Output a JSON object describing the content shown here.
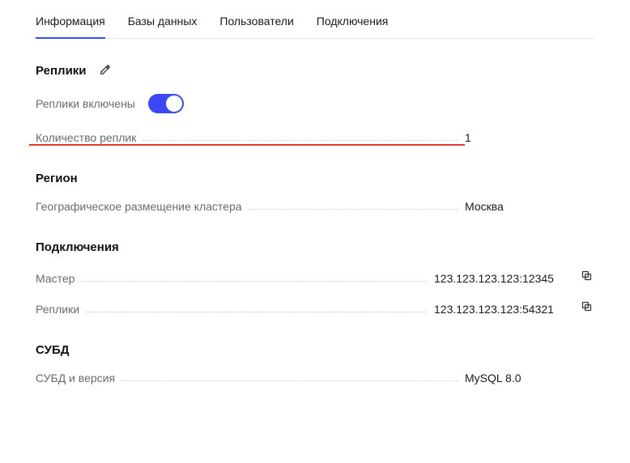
{
  "tabs": {
    "info": "Информация",
    "databases": "Базы данных",
    "users": "Пользователи",
    "connections": "Подключения"
  },
  "replicas": {
    "title": "Реплики",
    "toggle_label": "Реплики включены",
    "toggle_on": true,
    "count_label": "Количество реплик",
    "count_value": "1"
  },
  "region": {
    "title": "Регион",
    "placement_label": "Географическое размещение кластера",
    "placement_value": "Москва"
  },
  "connections": {
    "title": "Подключения",
    "master_label": "Мастер",
    "master_value": "123.123.123.123:12345",
    "replicas_label": "Реплики",
    "replicas_value": "123.123.123.123:54321"
  },
  "dbms": {
    "title": "СУБД",
    "version_label": "СУБД и версия",
    "version_value": "MySQL 8.0"
  }
}
